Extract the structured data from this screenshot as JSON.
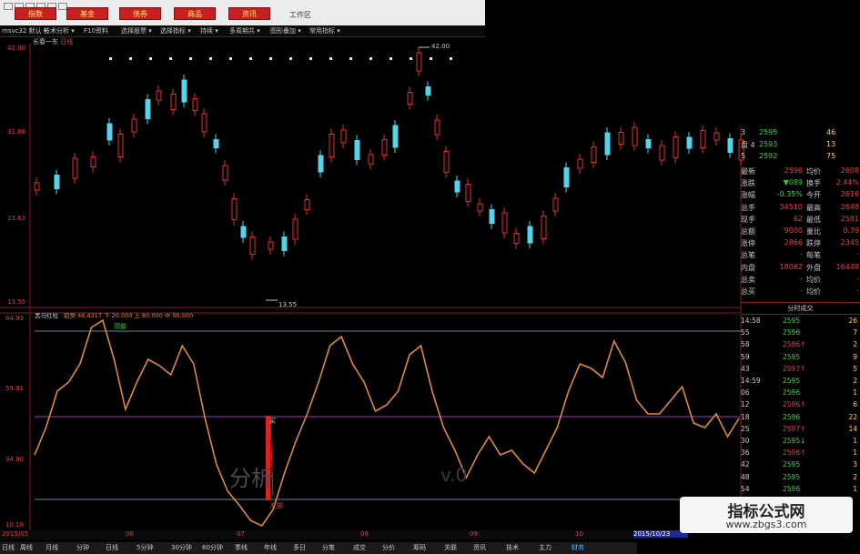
{
  "toolbar": {
    "buttons": [
      "指数",
      "基金",
      "债券",
      "商品",
      "资讯"
    ],
    "workarea": "工作区"
  },
  "menu": [
    "msvc32 默认 ▾",
    "技术分析 ▾",
    "F10资料",
    "选择股票 ▾",
    "选择指标 ▾",
    "持续 ▾",
    "多周期共 ▾",
    "图形叠加 ▾",
    "常用指标 ▾"
  ],
  "stock_title": {
    "name": "长春一东",
    "label": "日线"
  },
  "main_chart": {
    "yaxis": [
      "42.00",
      "31.88",
      "23.63",
      "13.55"
    ],
    "high_label": "42.00",
    "low_label": "13.55"
  },
  "indicator": {
    "name": "黑马红柱",
    "params": "趋势  46.4317  下  20.000  上  80.000  中  50.000",
    "yaxis": [
      "84.93",
      "59.91",
      "34.90",
      "10.18"
    ],
    "top_label": "顶部",
    "bottom_label": "底部",
    "buy_label": "买",
    "overlay_text": "分析",
    "overlay_text2": "v.0"
  },
  "date_axis": [
    "2015/05",
    "06",
    "07",
    "08",
    "09",
    "10"
  ],
  "date_highlight": "2015/10/23",
  "quote_top": [
    {
      "label": "3",
      "price": "2595",
      "vol": "46"
    },
    {
      "label": "盘 4",
      "price": "2593",
      "vol": "13"
    },
    {
      "label": "5",
      "price": "2592",
      "vol": "75"
    }
  ],
  "quote_stats": [
    {
      "k1": "最新",
      "v1": "2596",
      "k2": "均价",
      "v2": "2608"
    },
    {
      "k1": "涨跌",
      "v1": "▼089",
      "k2": "换手",
      "v2": "2.44%"
    },
    {
      "k1": "涨幅",
      "v1": "-0.35%",
      "k2": "今开",
      "v2": "2616"
    },
    {
      "k1": "总手",
      "v1": "34510",
      "k2": "最高",
      "v2": "2648"
    },
    {
      "k1": "现手",
      "v1": "62",
      "k2": "最低",
      "v2": "2581"
    },
    {
      "k1": "总额",
      "v1": "9000",
      "k2": "量比",
      "v2": "0.79"
    },
    {
      "k1": "涨停",
      "v1": "2866",
      "k2": "跌停",
      "v2": "2345"
    },
    {
      "k1": "总笔",
      "v1": "-",
      "k2": "每笔",
      "v2": "-"
    },
    {
      "k1": "内盘",
      "v1": "18062",
      "k2": "外盘",
      "v2": "16448"
    },
    {
      "k1": "总卖",
      "v1": "-",
      "k2": "均价",
      "v2": "-"
    },
    {
      "k1": "总买",
      "v1": "-",
      "k2": "均价",
      "v2": "-"
    }
  ],
  "tick_header": "分时成交",
  "ticks": [
    {
      "t": "14:58",
      "p": "2595",
      "v": "26"
    },
    {
      "t": "55",
      "p": "2596",
      "v": "7"
    },
    {
      "t": "58",
      "p": "2596↑",
      "v": "2"
    },
    {
      "t": "59",
      "p": "2595",
      "v": "9"
    },
    {
      "t": "43",
      "p": "2597↑",
      "v": "5"
    },
    {
      "t": "14:59",
      "p": "2595",
      "v": "2"
    },
    {
      "t": "06",
      "p": "2596",
      "v": "1"
    },
    {
      "t": "12",
      "p": "2596↑",
      "v": "6"
    },
    {
      "t": "18",
      "p": "2596",
      "v": "22"
    },
    {
      "t": "25",
      "p": "2597↑",
      "v": "14"
    },
    {
      "t": "30",
      "p": "2595↓",
      "v": "1"
    },
    {
      "t": "36",
      "p": "2596↑",
      "v": "1"
    },
    {
      "t": "42",
      "p": "2595",
      "v": "3"
    },
    {
      "t": "48",
      "p": "2595",
      "v": "2"
    },
    {
      "t": "54",
      "p": "2596",
      "v": "1"
    }
  ],
  "bottom_tabs": [
    "日线",
    "周线",
    "月线",
    "分钟",
    "日线",
    "5分钟",
    "30分钟",
    "60分钟",
    "季线",
    "年线",
    "多日",
    "分笔",
    "成交",
    "分价",
    "筹码",
    "关联",
    "资讯",
    "技术",
    "主力",
    "财务"
  ],
  "watermark": {
    "title": "指标公式网",
    "url": "www.zbgs3.com"
  },
  "colors": {
    "up": "#e03030",
    "down": "#54d4e8",
    "indicator_line": "#e08a3a",
    "bg": "#000000"
  }
}
